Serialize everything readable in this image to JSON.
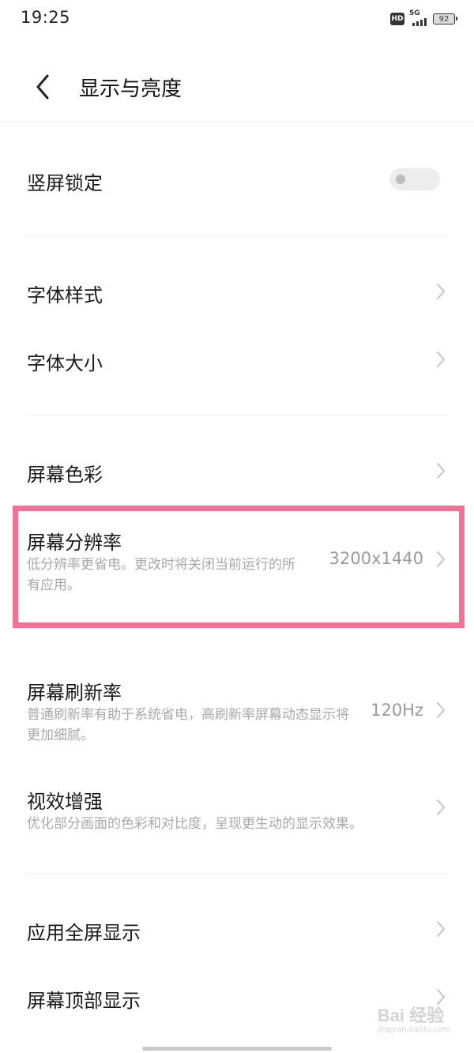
{
  "status_bar": {
    "time": "19:25",
    "hd_badge": "HD",
    "network": "5G",
    "battery": "92"
  },
  "header": {
    "title": "显示与亮度"
  },
  "settings": {
    "portrait_lock": {
      "title": "竖屏锁定",
      "enabled": false
    },
    "font_style": {
      "title": "字体样式"
    },
    "font_size": {
      "title": "字体大小"
    },
    "screen_color": {
      "title": "屏幕色彩"
    },
    "screen_resolution": {
      "title": "屏幕分辨率",
      "subtitle": "低分辨率更省电。更改时将关闭当前运行的所有应用。",
      "value": "3200x1440"
    },
    "refresh_rate": {
      "title": "屏幕刷新率",
      "subtitle": "普通刷新率有助于系统省电，高刷新率屏幕动态显示将更加细腻。",
      "value": "120Hz"
    },
    "visual_enhance": {
      "title": "视效增强",
      "subtitle": "优化部分画面的色彩和对比度，呈现更生动的显示效果。"
    },
    "fullscreen_apps": {
      "title": "应用全屏显示"
    },
    "top_display": {
      "title": "屏幕顶部显示"
    }
  },
  "colors": {
    "highlight_border": "#f07396",
    "secondary_text": "#a8a8a8"
  },
  "watermark": {
    "main": "Bai 经验",
    "sub": "jingyan.baidu.com"
  }
}
